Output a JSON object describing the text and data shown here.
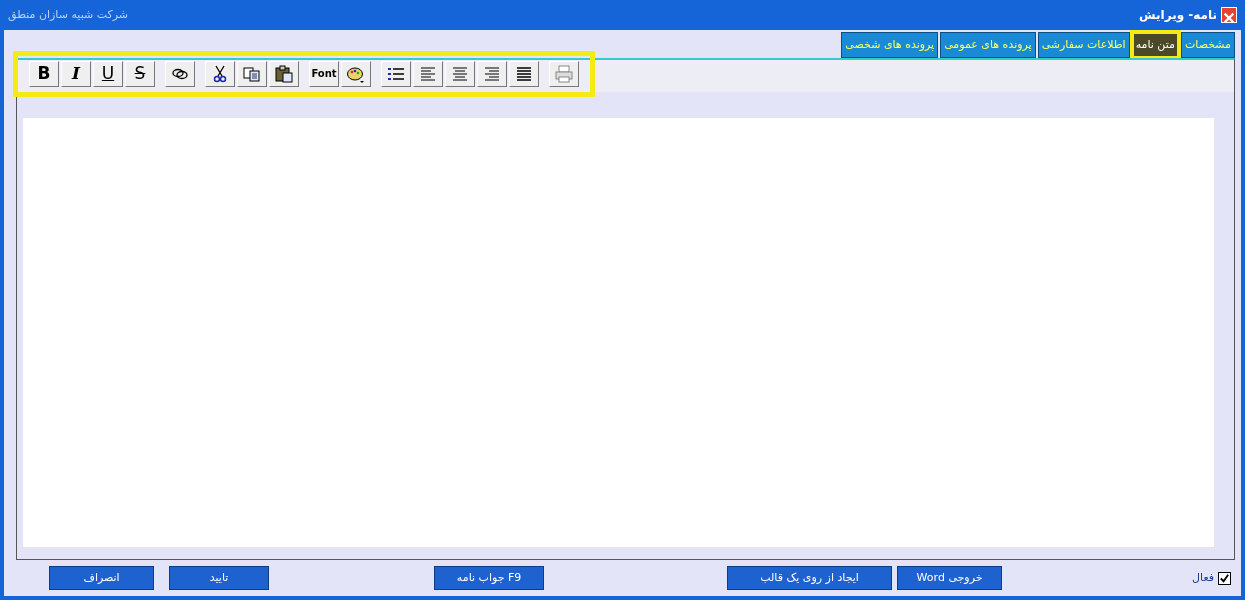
{
  "window": {
    "title": "نامه- ویرایش",
    "company": "شرکت شبیه سازان منطق"
  },
  "tabs": [
    {
      "label": "مشخصات",
      "selected": false,
      "highlighted": false
    },
    {
      "label": "متن نامه",
      "selected": true,
      "highlighted": true
    },
    {
      "label": "اطلاعات سفارشی",
      "selected": false,
      "highlighted": false
    },
    {
      "label": "پرونده های عمومی",
      "selected": false,
      "highlighted": false
    },
    {
      "label": "پرونده های شخصی",
      "selected": false,
      "highlighted": false
    }
  ],
  "toolbar": {
    "highlighted": true,
    "groups": [
      [
        {
          "kind": "print"
        }
      ],
      [
        {
          "kind": "justify"
        },
        {
          "kind": "align-right"
        },
        {
          "kind": "align-center"
        },
        {
          "kind": "align-left"
        },
        {
          "kind": "list"
        }
      ],
      [
        {
          "kind": "palette"
        },
        {
          "kind": "font",
          "label": "Font"
        }
      ],
      [
        {
          "kind": "paste"
        },
        {
          "kind": "copy"
        },
        {
          "kind": "cut"
        }
      ],
      [
        {
          "kind": "link"
        }
      ],
      [
        {
          "kind": "strike",
          "label": "S"
        },
        {
          "kind": "underline",
          "label": "U"
        },
        {
          "kind": "italic",
          "label": "I"
        },
        {
          "kind": "bold",
          "label": "B"
        }
      ]
    ]
  },
  "active": {
    "label": "فعال",
    "checked": true
  },
  "buttons": [
    {
      "label": "خروجی Word"
    },
    {
      "label": "ایجاد از روی یک قالب"
    },
    {
      "label": "F9 جواب نامه"
    },
    {
      "label": "تایید"
    },
    {
      "label": "انصراف"
    }
  ]
}
